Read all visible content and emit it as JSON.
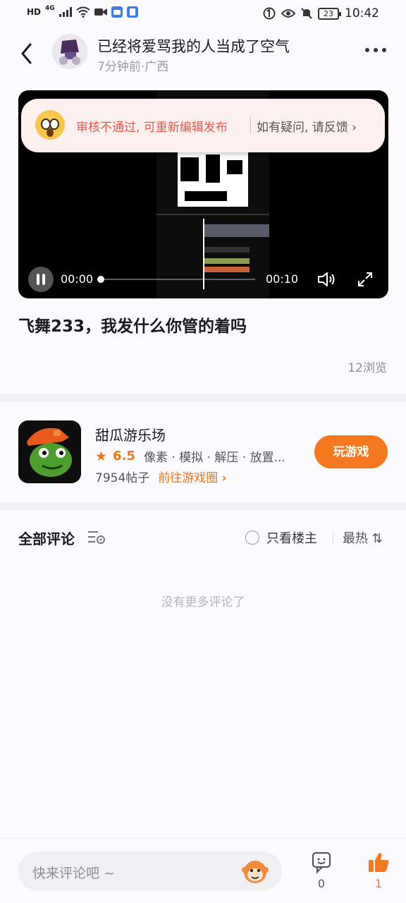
{
  "status_bar": {
    "left_labels": [
      "HD",
      "4G"
    ],
    "battery": "23",
    "time": "10:42"
  },
  "header": {
    "title": "已经将爱骂我的人当成了空气",
    "meta": "7分钟前·广西"
  },
  "video": {
    "notice_text": "审核不通过, 可重新编辑发布",
    "notice_link": "如有疑问, 请反馈 ›",
    "current_time": "00:00",
    "total_time": "00:10",
    "progress": 0.0
  },
  "post": {
    "title": "飞舞233，我发什么你管的着吗",
    "views": "12浏览"
  },
  "game": {
    "name": "甜瓜游乐场",
    "rating": "6.5",
    "tags": "像素 · 模拟 · 解压 · 放置...",
    "posts": "7954帖子",
    "goto_label": "前往游戏圈",
    "play_label": "玩游戏",
    "accent": "#f5781e"
  },
  "comments": {
    "title": "全部评论",
    "only_host": "只看楼主",
    "sort": "最热 ⇅",
    "empty": "没有更多评论了"
  },
  "bottom": {
    "placeholder": "快来评论吧 ~",
    "comment_count": "0",
    "like_count": "1"
  }
}
